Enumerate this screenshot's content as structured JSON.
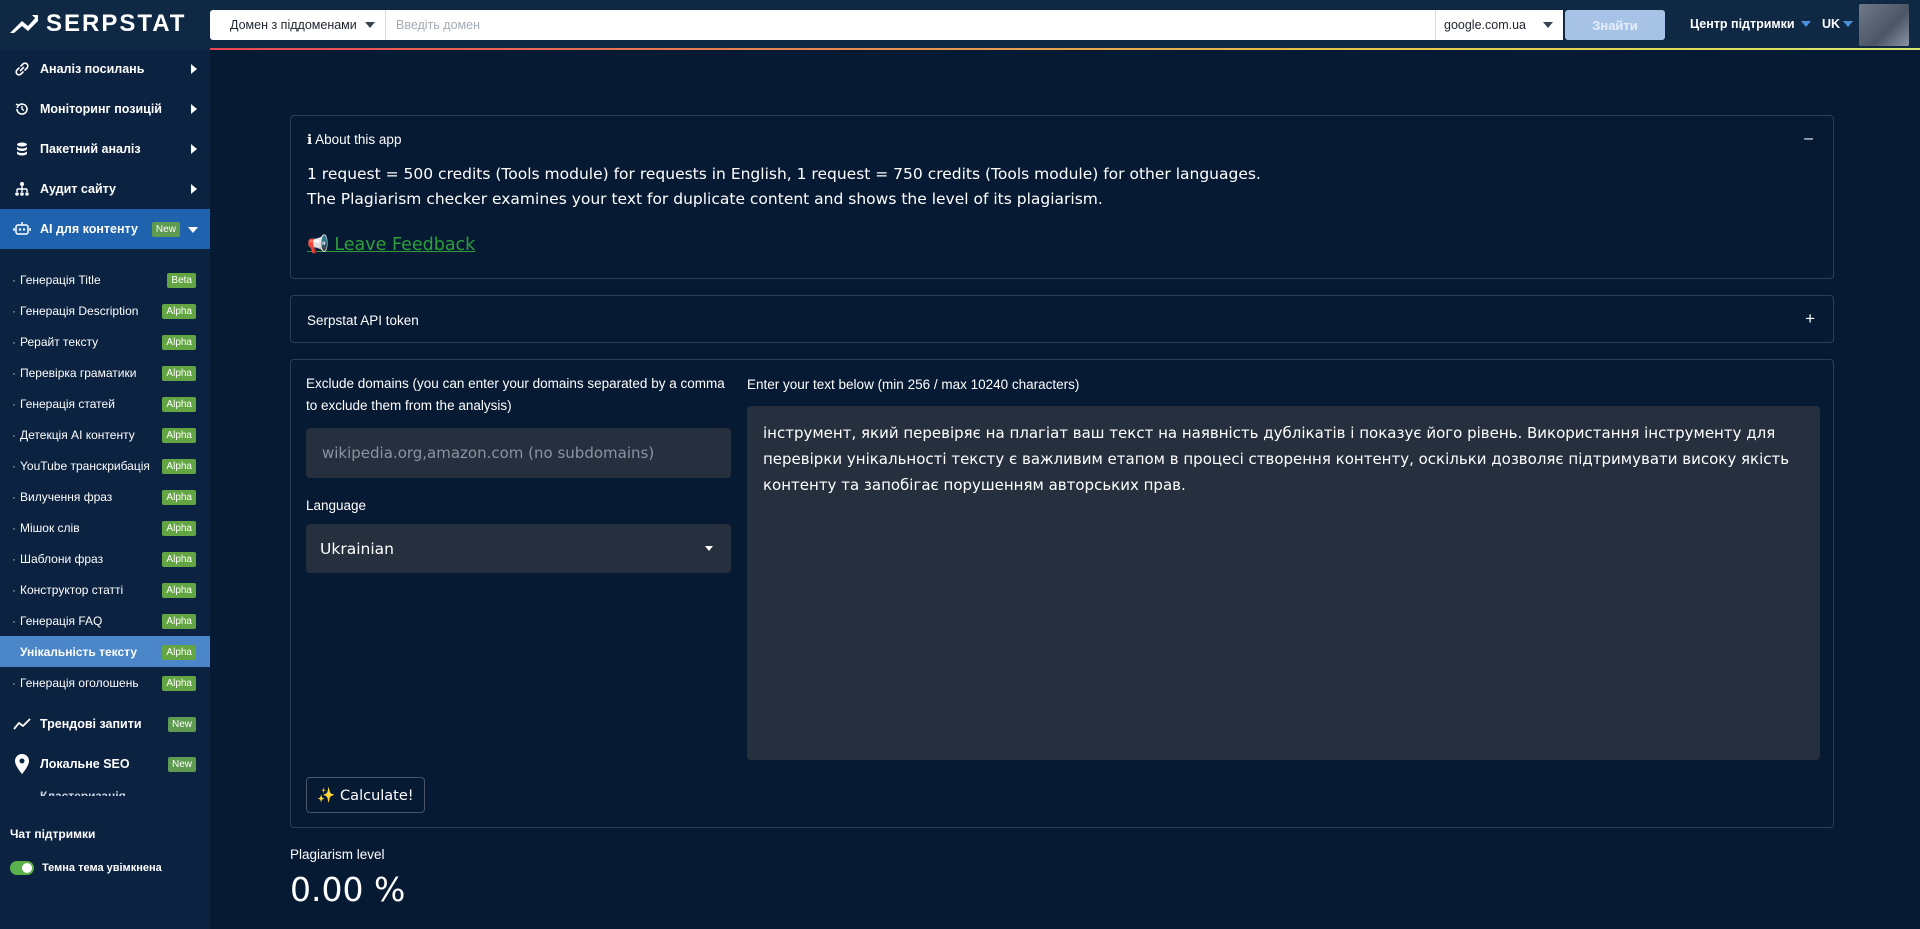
{
  "app": {
    "logo_text": "SERPSTAT"
  },
  "topbar": {
    "domain_mode": "Домен з піддоменами",
    "domain_placeholder": "Введіть домен",
    "engine": "google.com.ua",
    "find_label": "Знайти",
    "support_center": "Центр підтримки",
    "language": "UK"
  },
  "sidebar": {
    "main_items": [
      {
        "label": "Аналіз посилань",
        "icon": "link-icon"
      },
      {
        "label": "Моніторинг позицій",
        "icon": "history-icon"
      },
      {
        "label": "Пакетний аналіз",
        "icon": "database-icon"
      },
      {
        "label": "Аудит сайту",
        "icon": "sitemap-icon"
      },
      {
        "label": "AI для контенту",
        "icon": "robot-icon",
        "badge": "New"
      }
    ],
    "sub_items": [
      {
        "label": "Генерація Title",
        "badge": "Beta"
      },
      {
        "label": "Генерація Description",
        "badge": "Alpha"
      },
      {
        "label": "Рерайт тексту",
        "badge": "Alpha"
      },
      {
        "label": "Перевірка граматики",
        "badge": "Alpha"
      },
      {
        "label": "Генерація статей",
        "badge": "Alpha"
      },
      {
        "label": "Детекція AI контенту",
        "badge": "Alpha"
      },
      {
        "label": "YouTube транскрибація",
        "badge": "Alpha"
      },
      {
        "label": "Вилучення фраз",
        "badge": "Alpha"
      },
      {
        "label": "Мішок слів",
        "badge": "Alpha"
      },
      {
        "label": "Шаблони фраз",
        "badge": "Alpha"
      },
      {
        "label": "Конструктор статті",
        "badge": "Alpha"
      },
      {
        "label": "Генерація FAQ",
        "badge": "Alpha"
      },
      {
        "label": "Унікальність тексту",
        "badge": "Alpha"
      },
      {
        "label": "Генерація оголошень",
        "badge": "Alpha"
      }
    ],
    "bottom_items": [
      {
        "label": "Трендові запити",
        "icon": "trend-icon",
        "badge": "New"
      },
      {
        "label": "Локальне SEO",
        "icon": "map-pin-icon",
        "badge": "New"
      }
    ],
    "clipped_item": "Кластеризація",
    "support_chat": "Чат підтримки",
    "dark_theme_label": "Темна тема увімкнена"
  },
  "about": {
    "title": "ℹ About this app",
    "line1": "1 request = 500 credits (Tools module) for requests in English, 1 request = 750 credits (Tools module) for other languages.",
    "line2": "The Plagiarism checker examines your text for duplicate content and shows the level of its plagiarism.",
    "feedback": "📢 Leave Feedback"
  },
  "api_token": {
    "title": "Serpstat API token"
  },
  "form": {
    "exclude_label": "Exclude domains (you can enter your domains separated by a comma to exclude them from the analysis)",
    "exclude_placeholder": "wikipedia.org,amazon.com (no subdomains)",
    "language_label": "Language",
    "language_value": "Ukrainian",
    "text_label": "Enter your text below (min 256 / max 10240 characters)",
    "text_value": "інструмент, який перевіряє на плагіат ваш текст на наявність дублікатів і показує його рівень. Використання інструменту для перевірки унікальності тексту є важливим етапом в процесі створення контенту, оскільки дозволяє підтримувати високу якість контенту та запобігає порушенням авторських прав.",
    "calculate_label": "✨ Calculate!"
  },
  "result": {
    "label": "Plagiarism level",
    "value": "0.00 %"
  },
  "colors": {
    "background": "#061a33",
    "sidebar": "#0b2240",
    "active_nav": "#1f62ad",
    "active_sub": "#4a86c8",
    "badge_green": "#64a543",
    "link_green": "#2e9e3a",
    "field_bg": "#262f3d"
  }
}
